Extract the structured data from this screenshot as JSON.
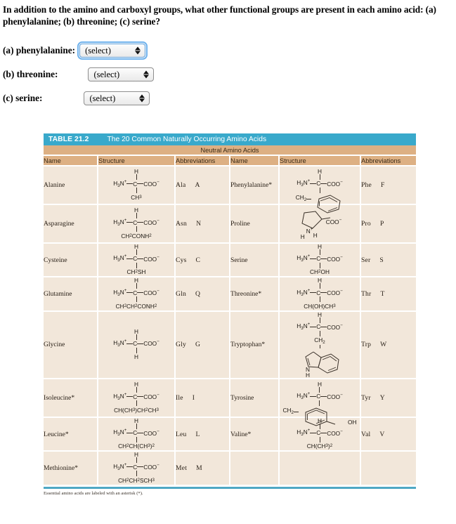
{
  "question": {
    "text": "In addition to the amino and carboxyl groups, what other functional groups are present in each amino acid: (a) phenylalanine; (b) threonine; (c) serine?"
  },
  "answers": [
    {
      "label": "(a) phenylalanine:",
      "value": "(select)",
      "focused": true
    },
    {
      "label": "(b) threonine:",
      "value": "(select)",
      "focused": false
    },
    {
      "label": "(c) serine:",
      "value": "(select)",
      "focused": false
    }
  ],
  "table": {
    "number": "TABLE 21.2",
    "title": "The 20 Common Naturally Occurring Amino Acids",
    "section_band": "Neutral Amino Acids",
    "headers": [
      "Name",
      "Structure",
      "Abbreviations",
      "Name",
      "Structure",
      "Abbreviations"
    ],
    "footnote": "Essential amino acids are labeled with an asterisk (*).",
    "colors": {
      "title_bar": "#39A9CB",
      "header_band": "#DDB083",
      "cell": "#F2E7DA",
      "rule": "#4FA8C4"
    },
    "rows": [
      {
        "left": {
          "name": "Alanine",
          "side_chain": "CH3",
          "abbr3": "Ala",
          "abbr1": "A"
        },
        "right": {
          "name": "Phenylalanine*",
          "side_chain": "CH2",
          "abbr3": "Phe",
          "abbr1": "F",
          "ring": "benzene"
        }
      },
      {
        "left": {
          "name": "Asparagine",
          "side_chain": "CH2CONH2",
          "abbr3": "Asn",
          "abbr1": "N"
        },
        "right": {
          "name": "Proline",
          "side_chain": "COO-",
          "abbr3": "Pro",
          "abbr1": "P",
          "ring": "pyrrolidine"
        }
      },
      {
        "left": {
          "name": "Cysteine",
          "side_chain": "CH2SH",
          "abbr3": "Cys",
          "abbr1": "C"
        },
        "right": {
          "name": "Serine",
          "side_chain": "CH2OH",
          "abbr3": "Ser",
          "abbr1": "S"
        }
      },
      {
        "left": {
          "name": "Glutamine",
          "side_chain": "CH2CH2CONH2",
          "abbr3": "Gln",
          "abbr1": "Q"
        },
        "right": {
          "name": "Threonine*",
          "side_chain": "CH(OH)CH3",
          "abbr3": "Thr",
          "abbr1": "T"
        }
      },
      {
        "left": {
          "name": "Glycine",
          "side_chain": "H",
          "abbr3": "Gly",
          "abbr1": "G"
        },
        "right": {
          "name": "Tryptophan*",
          "side_chain": "CH2",
          "abbr3": "Trp",
          "abbr1": "W",
          "ring": "indole"
        }
      },
      {
        "left": {
          "name": "Isoleucine*",
          "side_chain": "CH(CH3)CH2CH3",
          "abbr3": "Ile",
          "abbr1": "I"
        },
        "right": {
          "name": "Tyrosine",
          "side_chain": "CH2",
          "abbr3": "Tyr",
          "abbr1": "Y",
          "ring": "phenol"
        }
      },
      {
        "left": {
          "name": "Leucine*",
          "side_chain": "CH2CH(CH3)2",
          "abbr3": "Leu",
          "abbr1": "L"
        },
        "right": {
          "name": "Valine*",
          "side_chain": "CH(CH3)2",
          "abbr3": "Val",
          "abbr1": "V"
        }
      },
      {
        "left": {
          "name": "Methionine*",
          "side_chain": "CH2CH2SCH3",
          "abbr3": "Met",
          "abbr1": "M"
        },
        "right": {
          "name": "",
          "side_chain": "",
          "abbr3": "",
          "abbr1": ""
        }
      }
    ],
    "backbone": {
      "amino": "H3N",
      "carboxyl": "COO",
      "alpha": "C",
      "alpha_h": "H"
    }
  }
}
